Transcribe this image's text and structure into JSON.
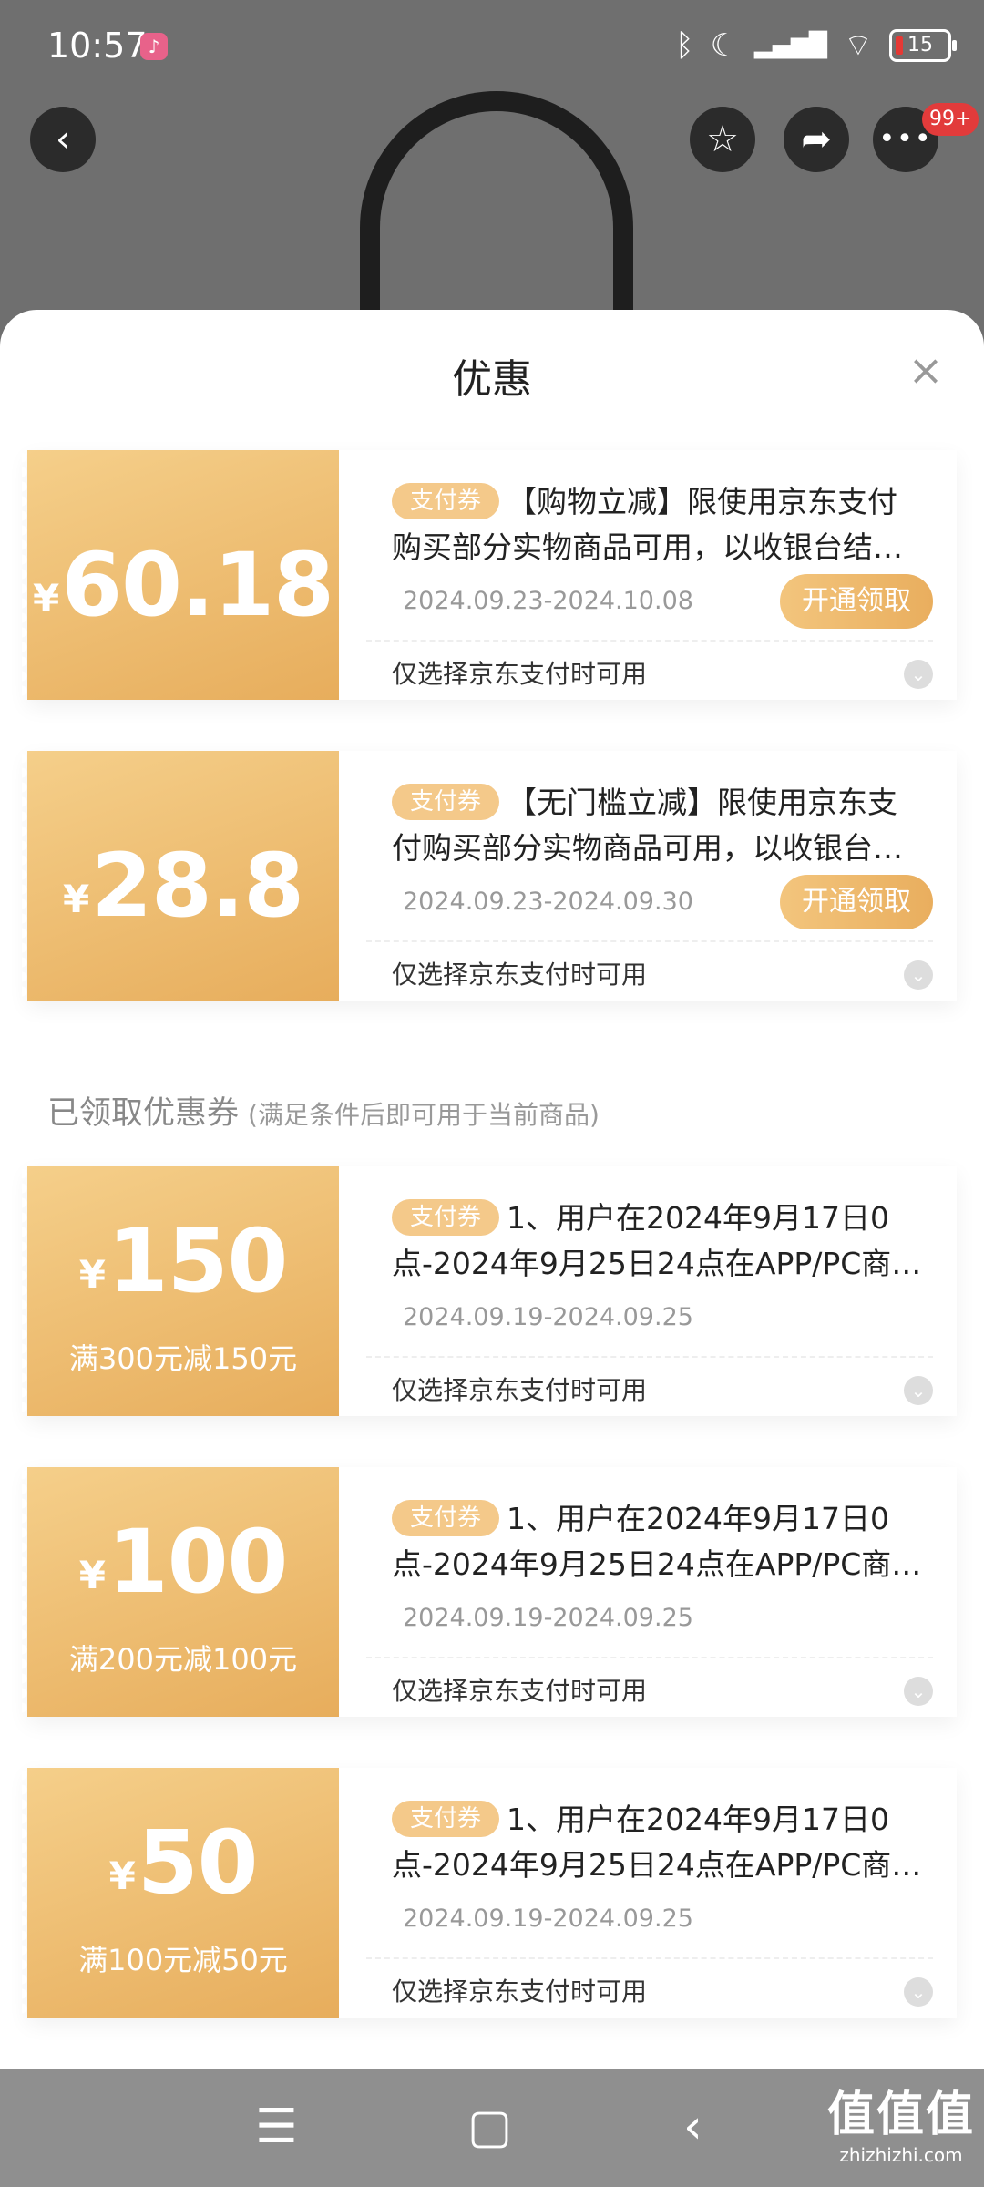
{
  "status_bar": {
    "time": "10:57",
    "app_icon": "music-note-icon",
    "battery": "15",
    "icons": [
      "bluetooth-icon",
      "moon-icon",
      "hd-signal-icon",
      "wifi-icon",
      "battery-icon"
    ]
  },
  "header": {
    "more_badge": "99+"
  },
  "sheet": {
    "title": "优惠",
    "close_glyph": "×"
  },
  "available_coupons": [
    {
      "currency": "¥",
      "amount": "60.18",
      "tag": "支付券",
      "desc_line1": "【购物立减】限使用京东支付",
      "desc_line2": "购买部分实物商品可用，以收银台结…",
      "date": "2024.09.23-2024.10.08",
      "claim_label": "开通领取",
      "condition": "仅选择京东支付时可用"
    },
    {
      "currency": "¥",
      "amount": "28.8",
      "tag": "支付券",
      "desc_line1": "【无门槛立减】限使用京东支",
      "desc_line2": "付购买部分实物商品可用，以收银台…",
      "date": "2024.09.23-2024.09.30",
      "claim_label": "开通领取",
      "condition": "仅选择京东支付时可用"
    }
  ],
  "claimed_section": {
    "title": "已领取优惠券",
    "subtitle": "(满足条件后即可用于当前商品)"
  },
  "claimed_coupons": [
    {
      "currency": "¥",
      "amount": "150",
      "threshold": "满300元减150元",
      "tag": "支付券",
      "desc_line1": "1、用户在2024年9月17日0",
      "desc_line2": "点-2024年9月25日24点在APP/PC商…",
      "date": "2024.09.19-2024.09.25",
      "condition": "仅选择京东支付时可用"
    },
    {
      "currency": "¥",
      "amount": "100",
      "threshold": "满200元减100元",
      "tag": "支付券",
      "desc_line1": "1、用户在2024年9月17日0",
      "desc_line2": "点-2024年9月25日24点在APP/PC商…",
      "date": "2024.09.19-2024.09.25",
      "condition": "仅选择京东支付时可用"
    },
    {
      "currency": "¥",
      "amount": "50",
      "threshold": "满100元减50元",
      "tag": "支付券",
      "desc_line1": "1、用户在2024年9月17日0",
      "desc_line2": "点-2024年9月25日24点在APP/PC商…",
      "date": "2024.09.19-2024.09.25",
      "condition": "仅选择京东支付时可用"
    }
  ],
  "navbar": {
    "watermark_big": "值值值",
    "watermark_small": "zhizhizhi.com"
  },
  "colors": {
    "coupon_gold_light": "#f5cf8a",
    "coupon_gold_dark": "#e7ad5c",
    "tag_bg": "#f4c98a"
  }
}
